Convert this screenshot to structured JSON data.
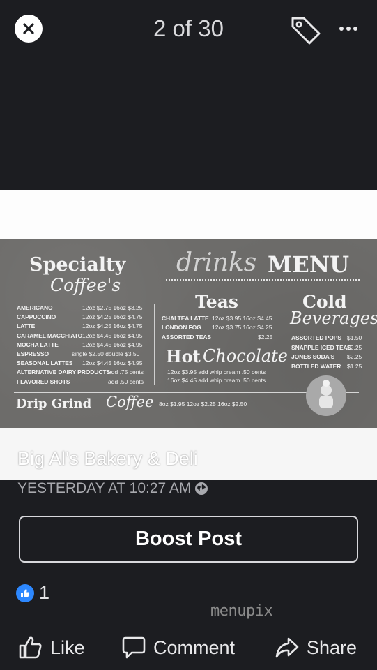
{
  "viewer": {
    "counter": "2 of 30",
    "icons": {
      "close": "close-icon",
      "tag": "tag-icon",
      "more": "more-dots-icon"
    }
  },
  "menu_photo": {
    "title_script": "drinks",
    "title_bold": "MENU",
    "specialty": {
      "heading_line1": "Specialty",
      "heading_line2": "Coffee's",
      "items": [
        {
          "name": "AMERICANO",
          "price": "12oz $2.75  16oz $3.25"
        },
        {
          "name": "CAPPUCCINO",
          "price": "12oz $4.25  16oz $4.75"
        },
        {
          "name": "LATTE",
          "price": "12oz $4.25  16oz $4.75"
        },
        {
          "name": "CARAMEL MACCHIATO",
          "price": "12oz $4.45  16oz $4.95"
        },
        {
          "name": "MOCHA LATTE",
          "price": "12oz $4.45  16oz $4.95"
        },
        {
          "name": "ESPRESSO",
          "price": "single $2.50  double $3.50"
        },
        {
          "name": "SEASONAL LATTES",
          "price": "12oz $4.45  16oz $4.95"
        },
        {
          "name": "ALTERNATIVE DAIRY PRODUCTS",
          "price": "add .75 cents"
        },
        {
          "name": "FLAVORED SHOTS",
          "price": "add .50 cents"
        }
      ]
    },
    "teas": {
      "heading": "Teas",
      "items": [
        {
          "name": "CHAI TEA LATTE",
          "price": "12oz $3.95  16oz $4.45"
        },
        {
          "name": "LONDON FOG",
          "price": "12oz $3.75  16oz $4.25"
        },
        {
          "name": "ASSORTED TEAS",
          "price": "$2.25"
        }
      ]
    },
    "hot_chocolate": {
      "heading_line1": "Hot",
      "heading_line2": "Chocolate",
      "lines": [
        "12oz $3.95  add whip cream .50 cents",
        "16oz $4.45  add whip cream .50 cents"
      ]
    },
    "cold": {
      "heading_line1": "Cold",
      "heading_line2": "Beverages",
      "items": [
        {
          "name": "ASSORTED POPS",
          "price": "$1.50"
        },
        {
          "name": "SNAPPLE ICED TEAS",
          "price": "$2.25"
        },
        {
          "name": "JONES SODA'S",
          "price": "$2.25"
        },
        {
          "name": "BOTTLED WATER",
          "price": "$1.25"
        }
      ]
    },
    "drip": {
      "heading_line1": "Drip Grind",
      "heading_line2": "Coffee",
      "prices": "8oz $1.95  12oz $2.25  16oz $2.50"
    }
  },
  "post": {
    "business_name": "Big Al's Bakery & Deli",
    "timestamp": "YESTERDAY AT 10:27 AM",
    "boost_label": "Boost Post",
    "reaction_count": "1",
    "watermark": "menupix"
  },
  "actions": {
    "like": "Like",
    "comment": "Comment",
    "share": "Share"
  },
  "colors": {
    "background": "#1c1d21",
    "like_blue": "#2d88ff",
    "board_gray": "#6d6c6a"
  }
}
